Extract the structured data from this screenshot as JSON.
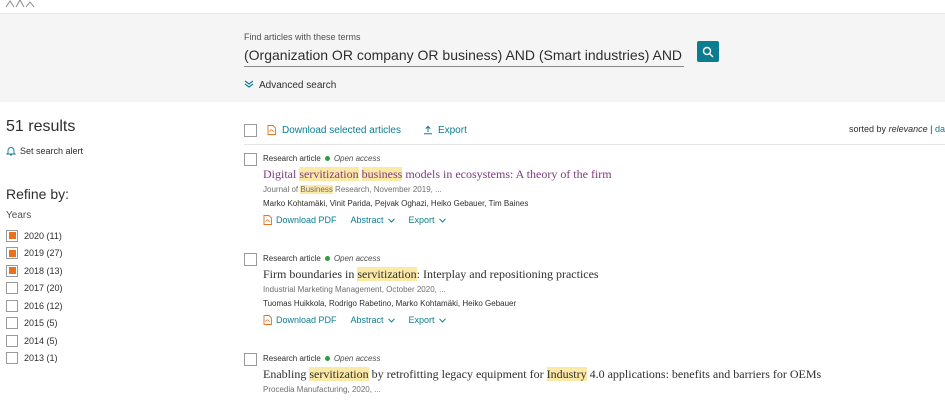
{
  "search": {
    "find_label": "Find articles with these terms",
    "query": "(Organization OR company OR business) AND (Smart industries) AND (gro",
    "advanced_label": "Advanced search"
  },
  "sidebar": {
    "results_count": "51 results",
    "alert_label": "Set search alert",
    "refine_label": "Refine by:",
    "years_label": "Years",
    "years": [
      {
        "label": "2020 (11)",
        "checked": true
      },
      {
        "label": "2019 (27)",
        "checked": true
      },
      {
        "label": "2018 (13)",
        "checked": true
      },
      {
        "label": "2017 (20)",
        "checked": false
      },
      {
        "label": "2016 (12)",
        "checked": false
      },
      {
        "label": "2015 (5)",
        "checked": false
      },
      {
        "label": "2014 (5)",
        "checked": false
      },
      {
        "label": "2013 (1)",
        "checked": false
      }
    ]
  },
  "toolbar": {
    "download_label": "Download selected articles",
    "export_label": "Export",
    "sorted_by": "sorted by",
    "sort_relevance": "relevance",
    "sort_separator": "|",
    "sort_date": "da"
  },
  "results": [
    {
      "type": "Research article",
      "access": "Open access",
      "title_parts": [
        "Digital ",
        "servitization",
        " ",
        "business",
        " models in ecosystems: A theory of the firm"
      ],
      "journal_parts": [
        "Journal of ",
        "Business",
        " Research, November 2019, ..."
      ],
      "authors": "Marko Kohtamäki, Vinit Parida, Pejvak Oghazi, Heiko Gebauer, Tim Baines",
      "download_pdf": "Download PDF",
      "abstract": "Abstract",
      "export": "Export"
    },
    {
      "type": "Research article",
      "access": "Open access",
      "title_parts": [
        "Firm boundaries in ",
        "servitization",
        ": Interplay and repositioning practices"
      ],
      "journal": "Industrial Marketing Management, October 2020, ...",
      "authors": "Tuomas Huikkola, Rodrigo Rabetino, Marko Kohtamäki, Heiko Gebauer",
      "download_pdf": "Download PDF",
      "abstract": "Abstract",
      "export": "Export"
    },
    {
      "type": "Research article",
      "access": "Open access",
      "title_parts": [
        "Enabling ",
        "servitization",
        " by retrofitting legacy equipment for ",
        "Industry",
        " 4.0 applications: benefits and barriers for OEMs"
      ],
      "journal": "Procedia Manufacturing, 2020, ..."
    }
  ],
  "colors": {
    "accent": "#0c7d91",
    "checkbox_checked": "#e9711c",
    "open_access_dot": "#2e9e3e",
    "highlight": "#fce9a6",
    "visited_title": "#7d3a7e"
  }
}
